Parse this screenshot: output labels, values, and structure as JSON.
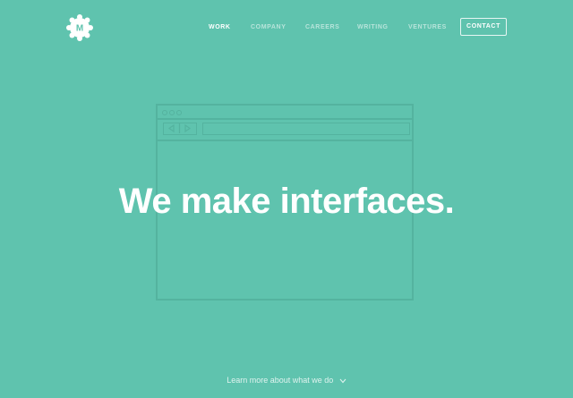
{
  "colors": {
    "background": "#5fc3ae",
    "outline": "#54b39f",
    "text": "#ffffff"
  },
  "logo": {
    "letter": "M",
    "icon": "logo-badge-icon"
  },
  "nav": {
    "items": [
      {
        "label": "WORK",
        "active": true
      },
      {
        "label": "COMPANY",
        "active": false
      },
      {
        "label": "CAREERS",
        "active": false
      },
      {
        "label": "WRITING",
        "active": false
      },
      {
        "label": "VENTURES",
        "active": false
      }
    ],
    "contact_label": "CONTACT"
  },
  "hero": {
    "headline": "We make interfaces.",
    "illustration": "browser-window-outline"
  },
  "footer": {
    "learn_more": "Learn more about what we do",
    "icon": "chevron-down-icon"
  }
}
